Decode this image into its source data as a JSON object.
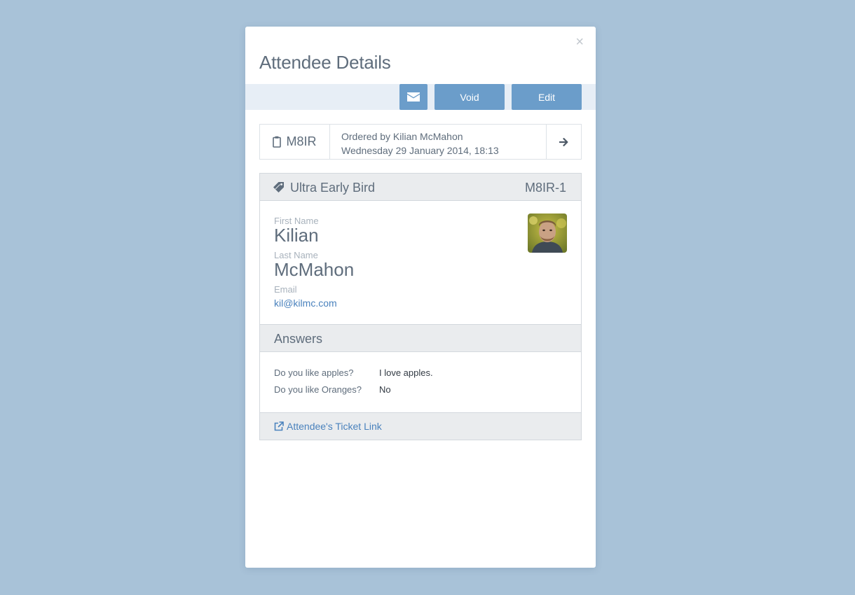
{
  "modal": {
    "title": "Attendee Details",
    "close_glyph": "×"
  },
  "toolbar": {
    "mail_icon": "envelope-icon",
    "void_label": "Void",
    "edit_label": "Edit"
  },
  "order": {
    "icon": "clipboard-icon",
    "reference": "M8IR",
    "ordered_by": "Ordered by Kilian McMahon",
    "date": "Wednesday 29 January 2014, 18:13",
    "go_icon": "arrow-right-icon"
  },
  "ticket": {
    "icon": "ticket-tag-icon",
    "type": "Ultra Early Bird",
    "code": "M8IR-1",
    "first_name_label": "First Name",
    "first_name": "Kilian",
    "last_name_label": "Last Name",
    "last_name": "McMahon",
    "email_label": "Email",
    "email": "kil@kilmc.com"
  },
  "answers": {
    "title": "Answers",
    "items": [
      {
        "question": "Do you like apples?",
        "answer": "I love apples."
      },
      {
        "question": "Do you like Oranges?",
        "answer": "No"
      }
    ]
  },
  "footer": {
    "icon": "external-link-icon",
    "link_label": "Attendee's Ticket Link"
  },
  "colors": {
    "background": "#a8c2d8",
    "accent": "#6b9dca",
    "link": "#4a82bd"
  }
}
